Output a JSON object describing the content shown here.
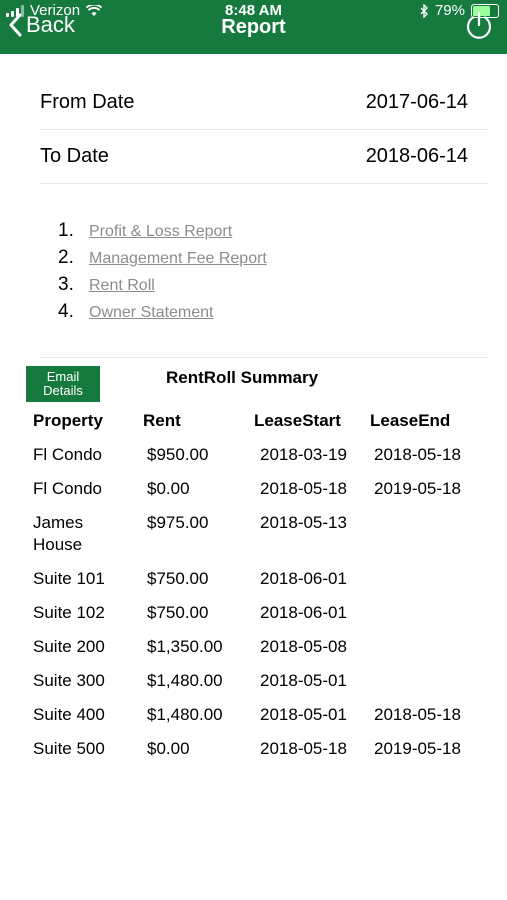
{
  "status_bar": {
    "carrier": "Verizon",
    "time": "8:48 AM",
    "battery": "79%",
    "battery_level": 0.79,
    "icons": [
      "signal-icon",
      "wifi-icon",
      "bluetooth-icon",
      "battery-icon"
    ]
  },
  "nav": {
    "back_label": "Back",
    "title": "Report",
    "power_icon": "power-icon"
  },
  "dates": {
    "from_label": "From Date",
    "from_value": "2017-06-14",
    "to_label": "To Date",
    "to_value": "2018-06-14"
  },
  "reports": [
    {
      "num": "1.",
      "label": "Profit & Loss Report"
    },
    {
      "num": "2.",
      "label": "Management Fee Report"
    },
    {
      "num": "3.",
      "label": "Rent Roll"
    },
    {
      "num": "4.",
      "label": "Owner Statement"
    }
  ],
  "summary": {
    "email_line1": "Email",
    "email_line2": "Details",
    "title": "RentRoll Summary",
    "columns": [
      "Property",
      "Rent",
      "LeaseStart",
      "LeaseEnd"
    ],
    "rows": [
      {
        "property": "Fl Condo",
        "rent": "$950.00",
        "lease_start": "2018-03-19",
        "lease_end": "2018-05-18"
      },
      {
        "property": "Fl Condo",
        "rent": "$0.00",
        "lease_start": "2018-05-18",
        "lease_end": "2019-05-18"
      },
      {
        "property": "James House",
        "rent": "$975.00",
        "lease_start": "2018-05-13",
        "lease_end": ""
      },
      {
        "property": "Suite 101",
        "rent": "$750.00",
        "lease_start": "2018-06-01",
        "lease_end": ""
      },
      {
        "property": "Suite 102",
        "rent": "$750.00",
        "lease_start": "2018-06-01",
        "lease_end": ""
      },
      {
        "property": "Suite 200",
        "rent": "$1,350.00",
        "lease_start": "2018-05-08",
        "lease_end": ""
      },
      {
        "property": "Suite 300",
        "rent": "$1,480.00",
        "lease_start": "2018-05-01",
        "lease_end": ""
      },
      {
        "property": "Suite 400",
        "rent": "$1,480.00",
        "lease_start": "2018-05-01",
        "lease_end": "2018-05-18"
      },
      {
        "property": "Suite 500",
        "rent": "$0.00",
        "lease_start": "2018-05-18",
        "lease_end": "2019-05-18"
      }
    ]
  },
  "colors": {
    "header_bg": "#167a3f",
    "link": "#8c8c8c",
    "button_bg": "#167a3f"
  }
}
